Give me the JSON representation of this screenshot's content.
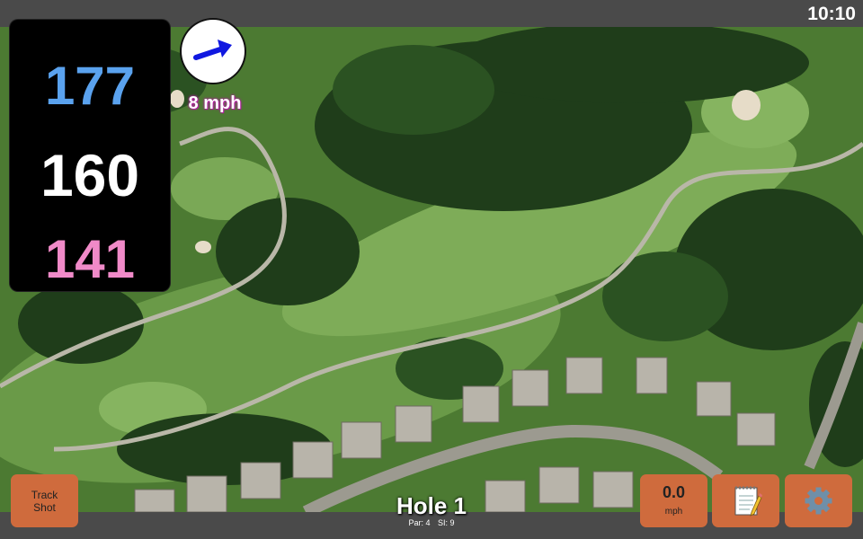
{
  "status": {
    "time": "10:10"
  },
  "distances": {
    "back": "177",
    "middle": "160",
    "front": "141"
  },
  "wind": {
    "speed": "8 mph",
    "icon": "wind-arrow-icon",
    "direction": "east-northeast"
  },
  "hole": {
    "title": "Hole 1",
    "par": "Par: 4",
    "stroke_index": "SI: 9"
  },
  "buttons": {
    "track_shot": {
      "line1": "Track",
      "line2": "Shot"
    },
    "speed": {
      "value": "0.0",
      "unit": "mph"
    },
    "notes": {
      "icon": "notepad-icon"
    },
    "settings": {
      "icon": "gear-icon"
    }
  },
  "colors": {
    "back": "#5aa2ee",
    "middle": "#ffffff",
    "front": "#f08ac8",
    "button": "#cf6b3d",
    "wind_text_glow": "#b21ea0",
    "wind_arrow": "#1018e0"
  }
}
